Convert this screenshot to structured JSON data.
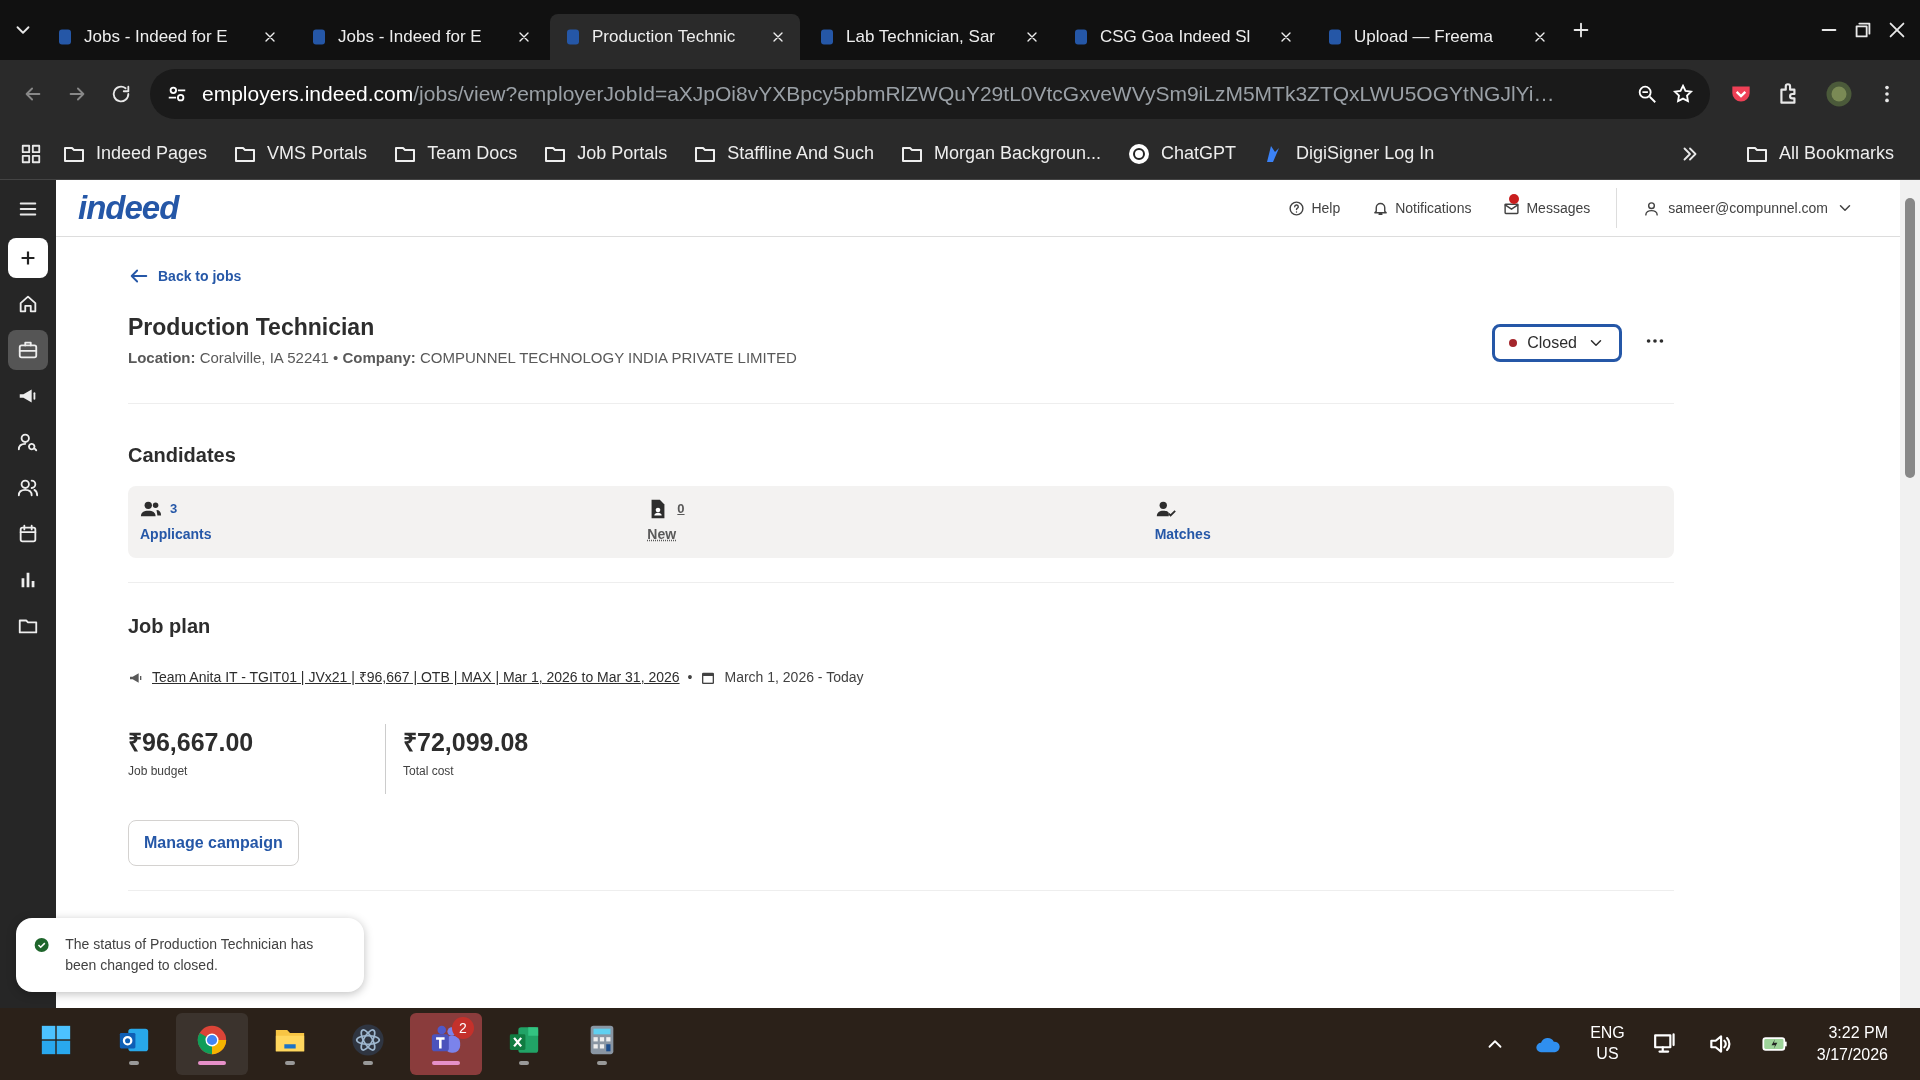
{
  "browser": {
    "tabs": [
      {
        "title": "Jobs - Indeed for E",
        "selected": false
      },
      {
        "title": "Jobs - Indeed for E",
        "selected": false
      },
      {
        "title": "Production Technic",
        "selected": true
      },
      {
        "title": "Lab Technician, Sar",
        "selected": false
      },
      {
        "title": "CSG Goa Indeed Sl",
        "selected": false
      },
      {
        "title": "Upload — Freema",
        "selected": false
      }
    ],
    "address": {
      "domain": "employers.indeed.com",
      "path": "/jobs/view?employerJobId=aXJpOi8vYXBpcy5pbmRlZWQuY29tL0VtcGxveWVySm9iLzM5MTk3ZTQxLWU5OGYtNGJlYi…"
    },
    "bookmarks": [
      {
        "label": "Indeed Pages",
        "kind": "folder"
      },
      {
        "label": "VMS Portals",
        "kind": "folder"
      },
      {
        "label": "Team Docs",
        "kind": "folder"
      },
      {
        "label": "Job Portals",
        "kind": "folder"
      },
      {
        "label": "Staffline And Such",
        "kind": "folder"
      },
      {
        "label": "Morgan Backgroun...",
        "kind": "folder"
      },
      {
        "label": "ChatGPT",
        "kind": "chat"
      },
      {
        "label": "DigiSigner Log In",
        "kind": "sign"
      }
    ],
    "all_bookmarks": "All Bookmarks"
  },
  "header": {
    "logo": "indeed",
    "help": "Help",
    "notifications": "Notifications",
    "messages": "Messages",
    "messages_unread": true,
    "user": "sameer@compunnel.com"
  },
  "sidebar": {
    "items": [
      {
        "selected": false
      },
      {
        "selected": false
      },
      {
        "selected": true
      },
      {
        "selected": false
      },
      {
        "selected": false
      },
      {
        "selected": false
      },
      {
        "selected": false
      },
      {
        "selected": false
      },
      {
        "selected": false
      }
    ]
  },
  "job": {
    "back_link": "Back to jobs",
    "title": "Production Technician",
    "details": "**Location:** Coralville, IA 52241 • **Company:** COMPUNNEL TECHNOLOGY INDIA PRIVATE LIMITED",
    "status": "Closed"
  },
  "candidates": {
    "title": "Candidates",
    "stats": [
      {
        "kind": "applicants",
        "count": "3",
        "label": "Applicants"
      },
      {
        "kind": "new",
        "count": "0",
        "label": "New"
      },
      {
        "kind": "matches",
        "label": "Matches"
      }
    ]
  },
  "job_plan": {
    "title": "Job plan",
    "campaign": "Team Anita IT - TGIT01 | JVx21 | ₹96,667 | OTB | MAX | Mar 1, 2026 to Mar 31, 2026",
    "separator": "•",
    "dates": "March 1, 2026 - Today",
    "amounts": [
      {
        "value": "₹96,667.00",
        "label": "Job budget"
      },
      {
        "value": "₹72,099.08",
        "label": "Total cost"
      }
    ],
    "button": "Manage campaign"
  },
  "toast": {
    "message": "The status of Production Technician has been changed to closed."
  },
  "taskbar": {
    "apps": [
      {
        "kind": "start",
        "running": false,
        "active": false
      },
      {
        "kind": "outlook",
        "running": true,
        "active": false
      },
      {
        "kind": "chrome",
        "running": true,
        "active": true
      },
      {
        "kind": "files",
        "running": true,
        "active": false
      },
      {
        "kind": "atom",
        "running": true,
        "active": false
      },
      {
        "kind": "teams",
        "running": true,
        "active": true,
        "badge": "2"
      },
      {
        "kind": "excel",
        "running": true,
        "active": false
      },
      {
        "kind": "calculator",
        "running": true,
        "active": false
      }
    ],
    "language": "ENG",
    "region": "US",
    "time": "3:22 PM",
    "date": "3/17/2026"
  }
}
